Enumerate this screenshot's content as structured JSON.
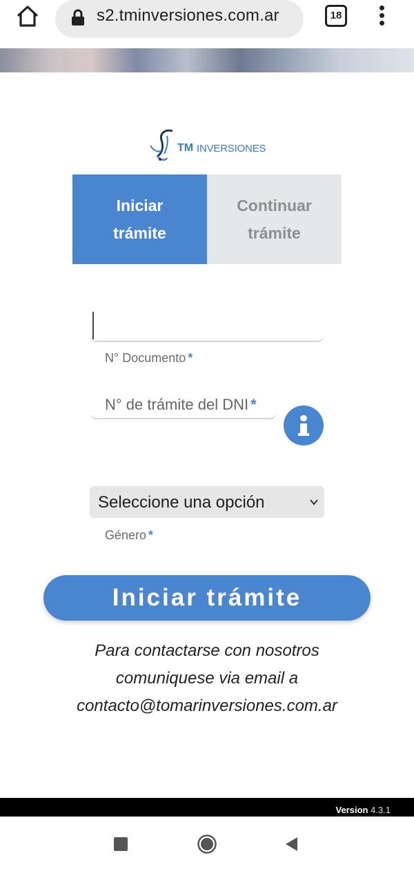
{
  "browser": {
    "url": "s2.tminversiones.com.ar",
    "tab_count": "18"
  },
  "logo": {
    "brand_bold": "TM",
    "brand_rest": "INVERSIONES"
  },
  "tabs": [
    {
      "label": "Iniciar\ntrámite",
      "active": true
    },
    {
      "label": "Continuar\ntrámite",
      "active": false
    }
  ],
  "form": {
    "documento": {
      "value": "",
      "label": "N° Documento",
      "required_mark": "*"
    },
    "tramite": {
      "placeholder": "N° de trámite del DNI",
      "required_mark": "*"
    },
    "genero": {
      "selected": "Seleccione una opción",
      "label": "Género",
      "required_mark": "*"
    },
    "submit_label": "Iniciar trámite"
  },
  "contact": {
    "line1": "Para contactarse con nosotros",
    "line2": "comuniquese via email a",
    "line3": "contacto@tomarinversiones.com.ar"
  },
  "footer": {
    "version_label": "Version",
    "version_number": "4.3.1"
  },
  "colors": {
    "accent": "#4a86cf",
    "inactive_tab": "#e6e7e8"
  },
  "icons": [
    "home-icon",
    "lock-icon",
    "tabs-icon",
    "overflow-menu-icon",
    "info-icon",
    "chevron-down-icon",
    "nav-recents-icon",
    "nav-home-icon",
    "nav-back-icon"
  ]
}
